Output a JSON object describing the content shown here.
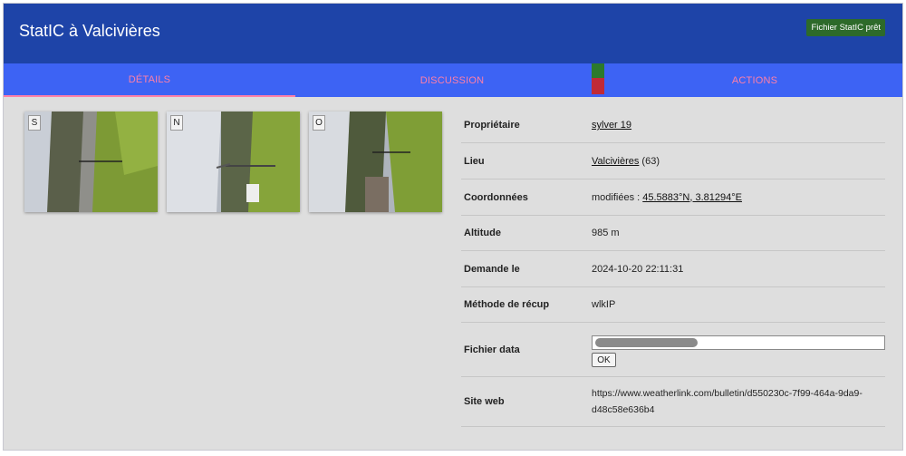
{
  "header": {
    "title": "StatIC à Valcivières",
    "badge": "Fichier StatIC prêt"
  },
  "tabs": [
    {
      "label": "Détails",
      "active": true
    },
    {
      "label": "Discussion",
      "active": false
    },
    {
      "label": "Actions",
      "active": false
    }
  ],
  "photos": [
    {
      "label": "S"
    },
    {
      "label": "N"
    },
    {
      "label": "O"
    }
  ],
  "details": {
    "owner": {
      "key": "Propriétaire",
      "value": "sylver 19"
    },
    "place": {
      "key": "Lieu",
      "link": "Valcivières",
      "suffix": " (63)"
    },
    "coords": {
      "key": "Coordonnées",
      "prefix": "modifiées : ",
      "link": "45.5883°N, 3.81294°E"
    },
    "altitude": {
      "key": "Altitude",
      "value": "985 m"
    },
    "requested": {
      "key": "Demande le",
      "value": "2024-10-20 22:11:31"
    },
    "method": {
      "key": "Méthode de récup",
      "value": "wlkIP"
    },
    "datafile": {
      "key": "Fichier data",
      "button": "OK"
    },
    "website": {
      "key": "Site web",
      "value": "https://www.weatherlink.com/bulletin/d550230c-7f99-464a-9da9-d48c58e636b4"
    }
  },
  "colors": {
    "header": "#1e44a8",
    "tabs": "#3d63f4",
    "tab_text": "#ff7fa6",
    "badge": "#2d6a2a"
  }
}
